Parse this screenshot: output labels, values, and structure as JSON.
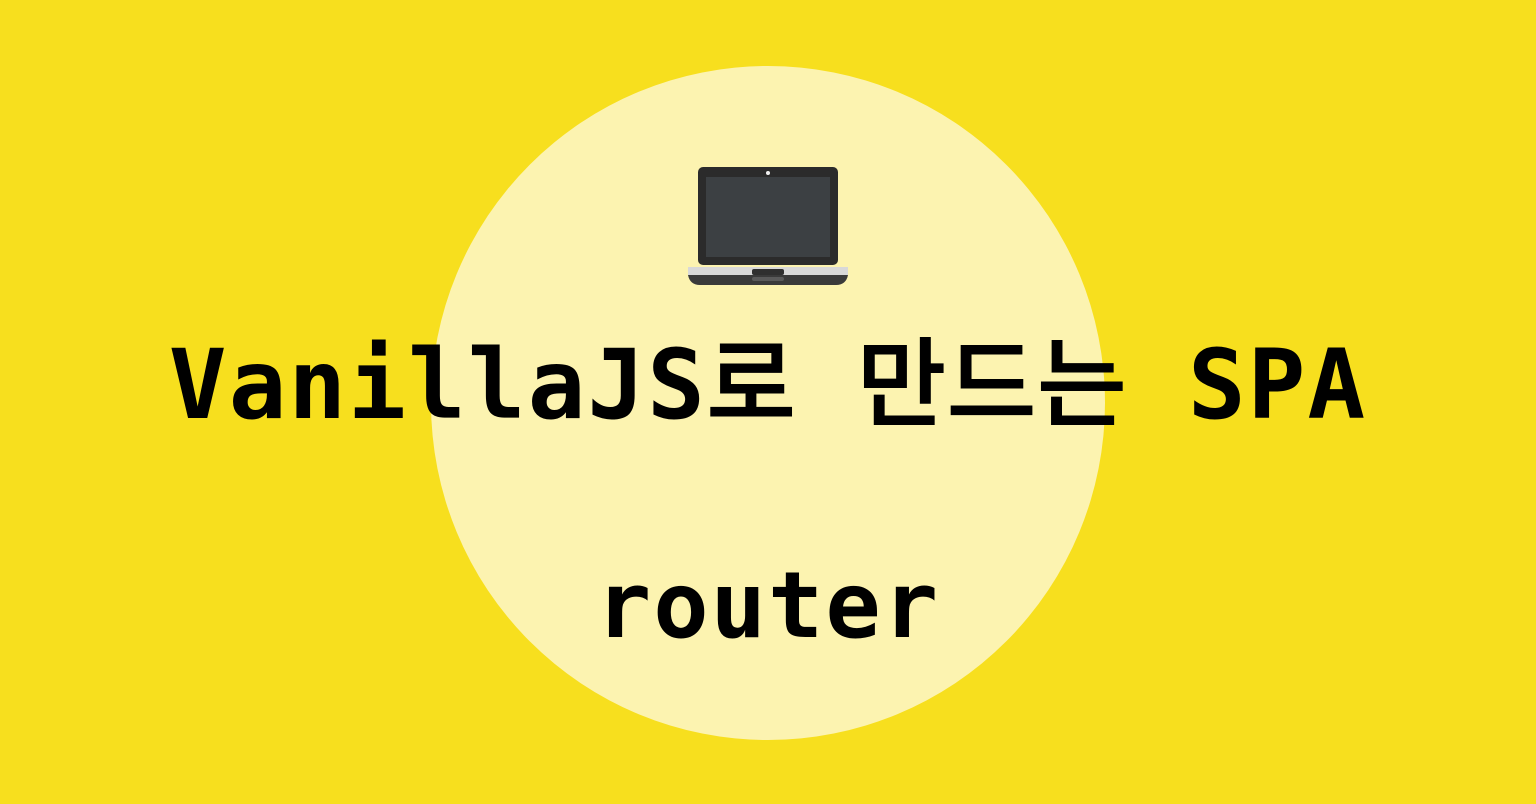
{
  "colors": {
    "background": "#f7df1e",
    "circle": "#fcf3b0",
    "text": "#000000"
  },
  "icon": "laptop-icon",
  "title": "VanillaJS로 만드는 SPA",
  "subtitle": "router"
}
